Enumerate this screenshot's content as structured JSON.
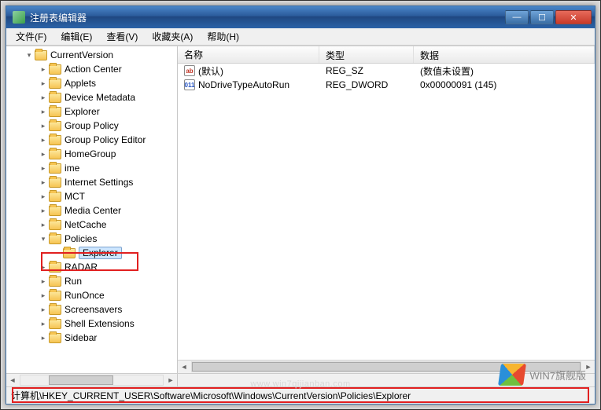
{
  "window": {
    "title": "注册表编辑器",
    "buttons": {
      "min": "—",
      "max": "☐",
      "close": "✕"
    }
  },
  "menu": {
    "file": "文件(F)",
    "edit": "编辑(E)",
    "view": "查看(V)",
    "favorites": "收藏夹(A)",
    "help": "帮助(H)"
  },
  "tree": {
    "root": "CurrentVersion",
    "items": [
      {
        "label": "Action Center"
      },
      {
        "label": "Applets"
      },
      {
        "label": "Device Metadata"
      },
      {
        "label": "Explorer"
      },
      {
        "label": "Group Policy"
      },
      {
        "label": "Group Policy Editor"
      },
      {
        "label": "HomeGroup"
      },
      {
        "label": "ime"
      },
      {
        "label": "Internet Settings"
      },
      {
        "label": "MCT"
      },
      {
        "label": "Media Center"
      },
      {
        "label": "NetCache"
      },
      {
        "label": "Policies",
        "expanded": true,
        "children": [
          {
            "label": "Explorer",
            "selected": true
          }
        ]
      },
      {
        "label": "RADAR"
      },
      {
        "label": "Run"
      },
      {
        "label": "RunOnce"
      },
      {
        "label": "Screensavers"
      },
      {
        "label": "Shell Extensions"
      },
      {
        "label": "Sidebar"
      }
    ]
  },
  "list": {
    "columns": {
      "name": "名称",
      "type": "类型",
      "data": "数据"
    },
    "rows": [
      {
        "icon": "str",
        "name": "(默认)",
        "type": "REG_SZ",
        "data": "(数值未设置)"
      },
      {
        "icon": "bin",
        "name": "NoDriveTypeAutoRun",
        "type": "REG_DWORD",
        "data": "0x00000091 (145)"
      }
    ]
  },
  "status": {
    "prefix": "计算机",
    "path": "\\HKEY_CURRENT_USER\\Software\\Microsoft\\Windows\\CurrentVersion\\Policies\\Explorer"
  },
  "watermark": {
    "text": "WIN7旗舰版",
    "url": "www.win7qijianban.com"
  }
}
